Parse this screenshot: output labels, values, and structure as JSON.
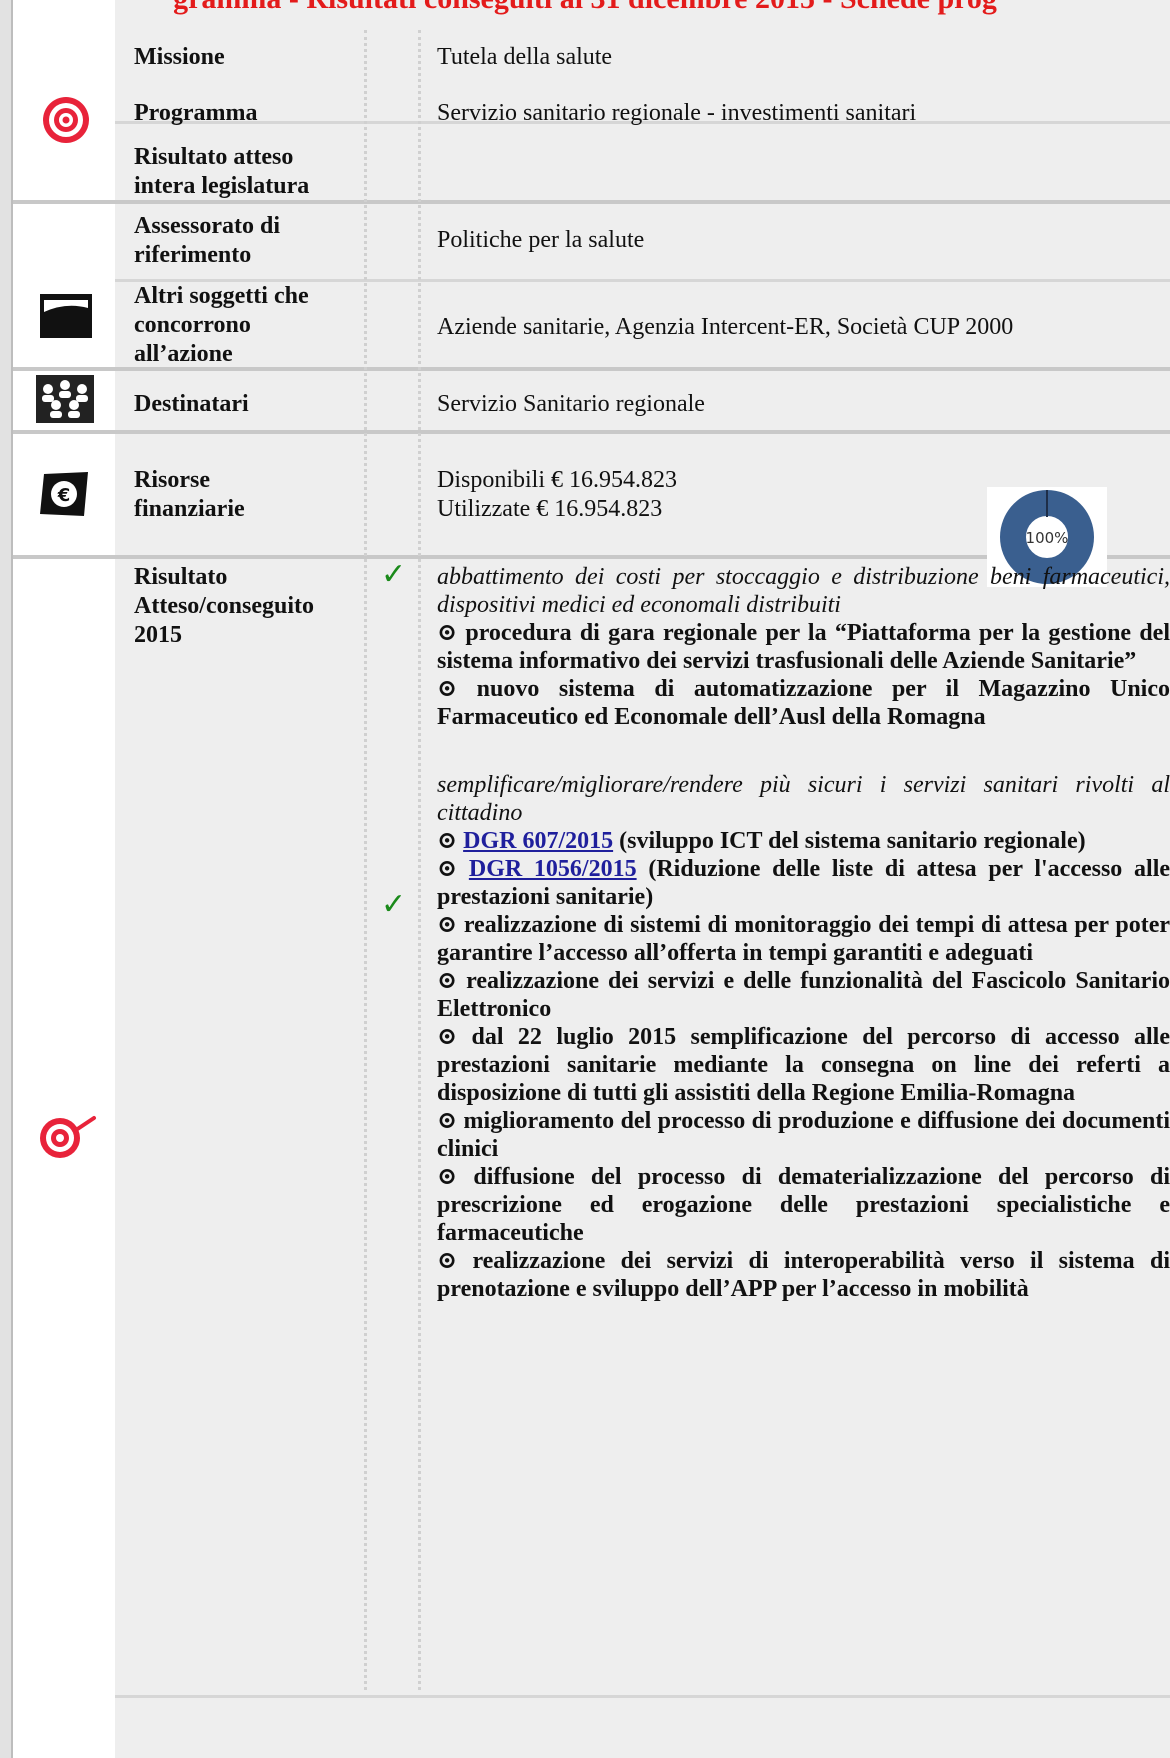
{
  "page": {
    "title": "gramma - Risultati conseguiti al 31 dicembre 2015 - Schede prog"
  },
  "rows": {
    "missione": {
      "label": "Missione",
      "value": "Tutela della salute"
    },
    "programma": {
      "label": "Programma",
      "value": "Servizio sanitario regionale - investimenti sanitari"
    },
    "risultato_atteso": {
      "label_line1": "Risultato atteso",
      "label_line2": "intera legislatura",
      "value": ""
    },
    "assessorato": {
      "label_line1": "Assessorato di",
      "label_line2": "riferimento",
      "value": "Politiche per la salute"
    },
    "altri_soggetti": {
      "label_line1": "Altri soggetti che",
      "label_line2": "concorrono",
      "label_line3": "all’azione",
      "value": "Aziende sanitarie, Agenzia Intercent-ER, Società CUP 2000"
    },
    "destinatari": {
      "label": "Destinatari",
      "value": "Servizio Sanitario regionale"
    },
    "risorse": {
      "label_line1": "Risorse",
      "label_line2": "finanziarie",
      "disponibili": "Disponibili € 16.954.823",
      "utilizzate": "Utilizzate € 16.954.823"
    },
    "risultato_2015": {
      "label_line1": "Risultato",
      "label_line2": "Atteso/conseguito",
      "label_line3": "2015"
    }
  },
  "chart_data": {
    "type": "pie",
    "values": [
      100
    ],
    "center_label": "100%",
    "colors": [
      "#3a5f8f"
    ]
  },
  "icons": {
    "row1": "target-icon",
    "row2": "flag-icon",
    "row3": "people-icon",
    "row4": "euro-icon",
    "row5": "target-dart-icon"
  },
  "results": {
    "check_symbol": "✓",
    "bullet": "⊙",
    "group1": {
      "intro": "abbattimento dei costi per stoccaggio e distribuzione beni farmaceutici, dispositivi medici ed economali distribuiti",
      "items": [
        "procedura di gara regionale per la “Piattaforma per la gestione del sistema informativo dei servizi trasfusionali delle Aziende Sanitarie”",
        "nuovo sistema di automatizzazione per il Magazzino Unico Farmaceutico ed Economale dell’Ausl della Romagna"
      ]
    },
    "group2": {
      "intro": "semplificare/migliorare/rendere più sicuri i servizi sanitari rivolti al cittadino",
      "link1": {
        "text": "DGR 607/2015",
        "rest": "(sviluppo ICT del sistema sanitario regionale)"
      },
      "link2": {
        "text": "DGR 1056/2015",
        "rest": "(Riduzione delle liste di attesa per l'accesso alle prestazioni sanitarie)"
      },
      "items": [
        "realizzazione di sistemi di monitoraggio dei tempi di attesa per poter garantire l’accesso all’offerta in tempi garantiti e adeguati",
        "realizzazione dei servizi e delle funzionalità del Fascicolo Sanitario Elettronico",
        "dal 22 luglio 2015 semplificazione del percorso di accesso alle prestazioni sanitarie mediante la consegna on line dei referti a disposizione di tutti gli assistiti della Regione Emilia-Romagna",
        "miglioramento del processo di produzione e diffusione dei documenti clinici",
        "diffusione del processo di dematerializzazione del percorso di prescrizione ed erogazione delle prestazioni specialistiche e farmaceutiche",
        "realizzazione dei servizi di interoperabilità verso il sistema di prenotazione e sviluppo dell’APP per l’accesso in mobilità"
      ]
    }
  }
}
